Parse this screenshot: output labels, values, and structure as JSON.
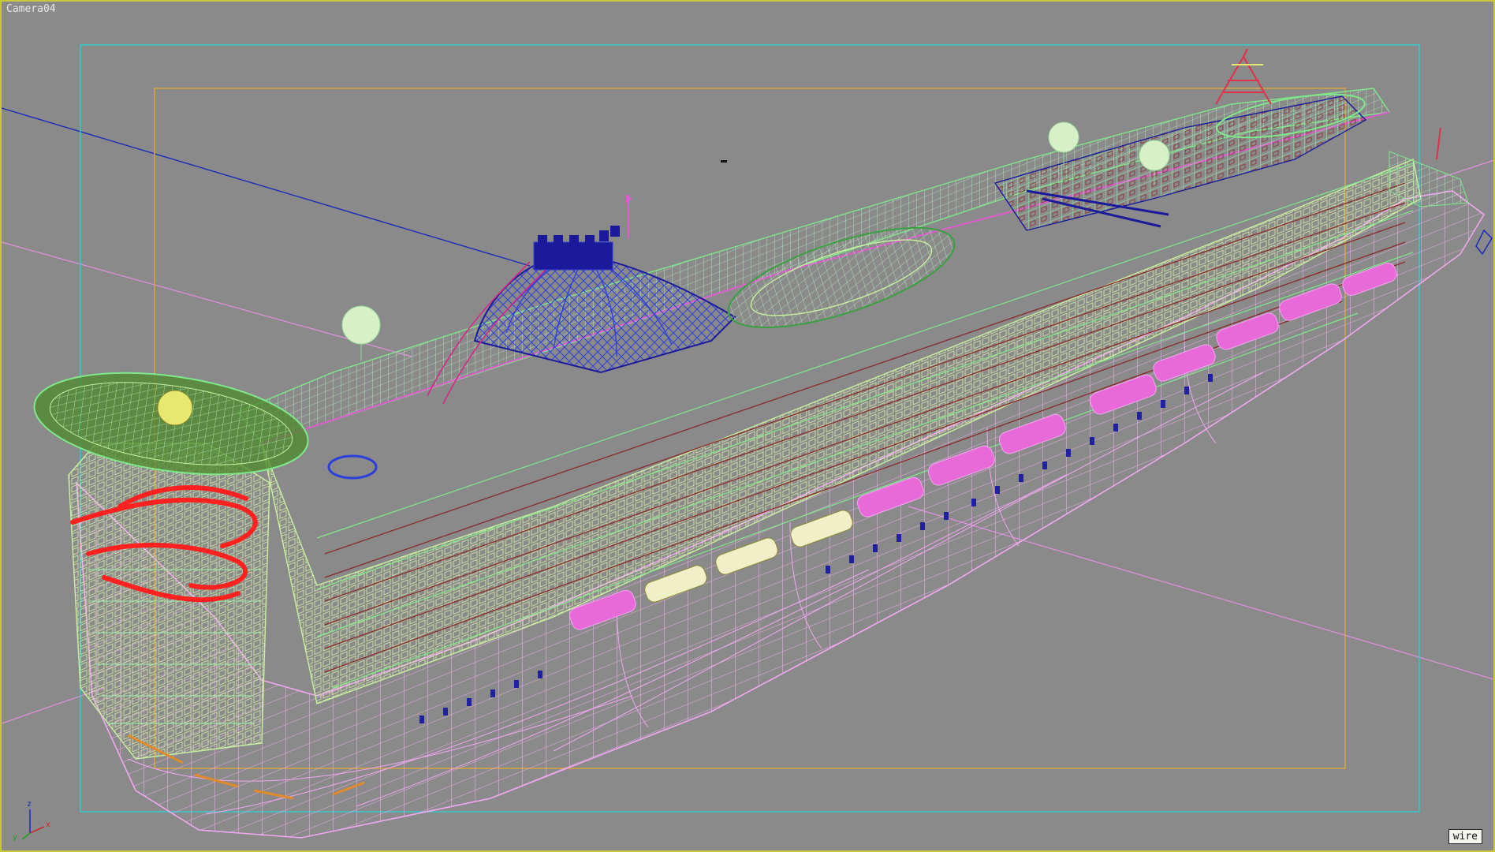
{
  "viewport": {
    "label": "Camera04",
    "render_mode": "wire",
    "background": "#8a8a8a",
    "frame_color": "#c8c83a"
  },
  "frames": {
    "safe_frame_outer_color": "#38c8c8",
    "safe_frame_inner_color": "#d6a440"
  },
  "axis_gizmo": {
    "z_label": "z",
    "x_label": "x",
    "y_label": "y",
    "icon": "axis-tripod-icon"
  },
  "model": {
    "name": "cruise-ship-wireframe",
    "hull_color": "#e8a6e8",
    "deck_colors": [
      "#7fe88a",
      "#c8f0a0",
      "#8a2a2a",
      "#e05ad0",
      "#3a8a3a",
      "#1a1a9a",
      "#e8e870",
      "#ff3030"
    ]
  }
}
